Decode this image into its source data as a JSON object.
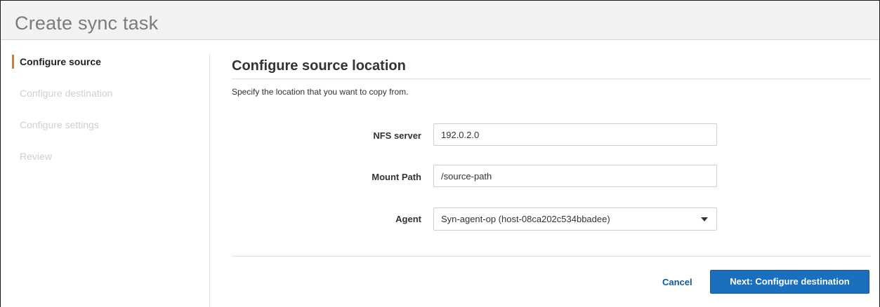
{
  "header": {
    "title": "Create sync task"
  },
  "sidebar": {
    "steps": [
      {
        "label": "Configure source",
        "active": true
      },
      {
        "label": "Configure destination",
        "active": false
      },
      {
        "label": "Configure settings",
        "active": false
      },
      {
        "label": "Review",
        "active": false
      }
    ]
  },
  "main": {
    "section_title": "Configure source location",
    "description": "Specify the location that you want to copy from.",
    "fields": {
      "nfs_server": {
        "label": "NFS server",
        "value": "192.0.2.0"
      },
      "mount_path": {
        "label": "Mount Path",
        "value": "/source-path"
      },
      "agent": {
        "label": "Agent",
        "selected": "Syn-agent-op (host-08ca202c534bbadee)",
        "icon": "chevron-down-icon"
      }
    }
  },
  "footer": {
    "cancel_label": "Cancel",
    "next_label": "Next: Configure destination"
  },
  "colors": {
    "accent": "#e07a1d",
    "primary_button": "#1a6fbf",
    "link": "#0c5a9e"
  }
}
